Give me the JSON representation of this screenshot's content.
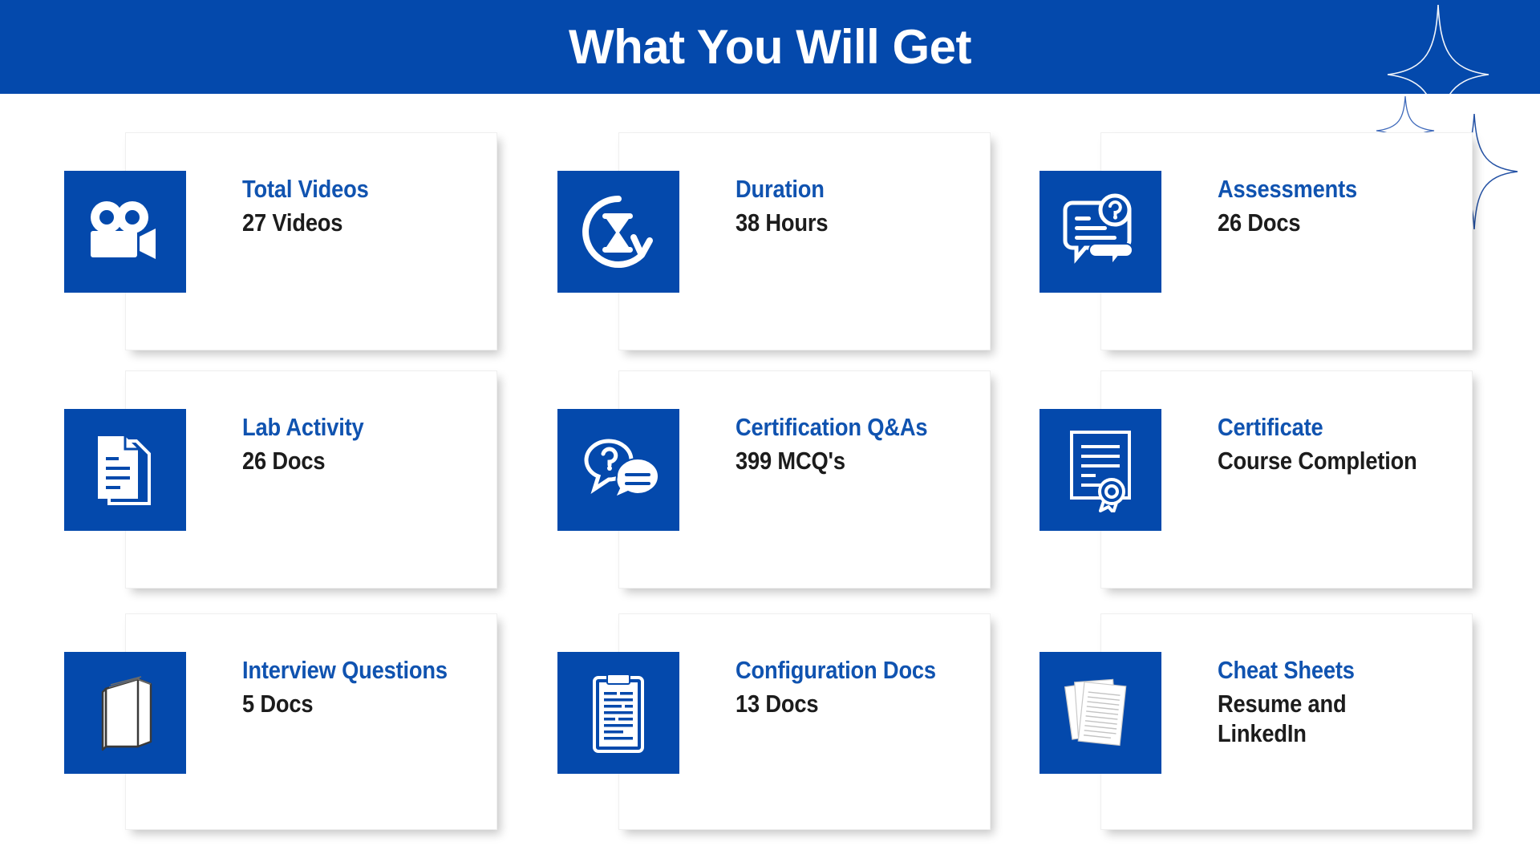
{
  "header": {
    "title": "What You Will Get",
    "background_color": "#0449ac",
    "title_color": "#ffffff"
  },
  "decorations": {
    "sparkles": [
      "sparkle-large-icon",
      "sparkle-small-icon",
      "sparkle-medium-icon"
    ]
  },
  "theme": {
    "accent_blue": "#0449ac",
    "title_blue": "#1053b0",
    "value_dark": "#1c1c1c",
    "card_background": "#ffffff"
  },
  "cards": [
    {
      "icon": "video-camera-icon",
      "title": "Total Videos",
      "value": "27 Videos",
      "value_lines": [
        "27 Videos"
      ]
    },
    {
      "icon": "hourglass-refresh-icon",
      "title": "Duration",
      "value": "38 Hours",
      "value_lines": [
        "38 Hours"
      ]
    },
    {
      "icon": "assessment-speech-question-icon",
      "title": "Assessments",
      "value": "26 Docs",
      "value_lines": [
        "26 Docs"
      ]
    },
    {
      "icon": "documents-stack-icon",
      "title": "Lab Activity",
      "value": "26 Docs",
      "value_lines": [
        "26 Docs"
      ]
    },
    {
      "icon": "question-chat-bubbles-icon",
      "title": "Certification Q&As",
      "value": "399 MCQ's",
      "value_lines": [
        "399 MCQ's"
      ]
    },
    {
      "icon": "certificate-ribbon-icon",
      "title": "Certificate",
      "value": "Course Completion",
      "value_lines": [
        "Course Completion"
      ]
    },
    {
      "icon": "book-icon",
      "title": "Interview Questions",
      "value": "5 Docs",
      "value_lines": [
        "5 Docs"
      ]
    },
    {
      "icon": "clipboard-icon",
      "title": "Configuration Docs",
      "value": "13 Docs",
      "value_lines": [
        "13 Docs"
      ]
    },
    {
      "icon": "paper-sheets-icon",
      "title": "Cheat Sheets",
      "value": "Resume and LinkedIn",
      "value_lines": [
        "Resume and",
        "LinkedIn"
      ]
    }
  ]
}
